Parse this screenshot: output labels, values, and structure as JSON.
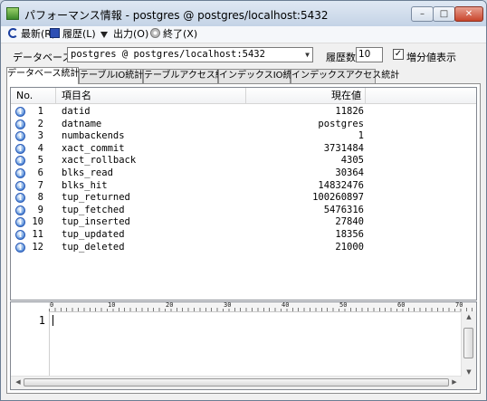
{
  "window": {
    "title": "パフォーマンス情報 - postgres @ postgres/localhost:5432",
    "minimize": "–",
    "maximize": "□",
    "close": "✕"
  },
  "menu": {
    "refresh": "最新(R)",
    "history": "履歴(L)",
    "output": "出力(O)",
    "exit": "終了(X)"
  },
  "toolbar": {
    "database_label": "データベース",
    "database_value": "postgres @ postgres/localhost:5432",
    "history_label": "履歴数",
    "history_value": "10",
    "increment_label": "増分値表示",
    "increment_checked": "✓"
  },
  "tabs": [
    "データベース統計",
    "テーブルIO統計",
    "テーブルアクセス統計",
    "インデックスIO統計",
    "インデックスアクセス統計"
  ],
  "list": {
    "columns": {
      "no": "No.",
      "name": "項目名",
      "value": "現在値"
    },
    "info_glyph": "i",
    "rows": [
      {
        "no": "1",
        "name": "datid",
        "value": "11826"
      },
      {
        "no": "2",
        "name": "datname",
        "value": "postgres"
      },
      {
        "no": "3",
        "name": "numbackends",
        "value": "1"
      },
      {
        "no": "4",
        "name": "xact_commit",
        "value": "3731484"
      },
      {
        "no": "5",
        "name": "xact_rollback",
        "value": "4305"
      },
      {
        "no": "6",
        "name": "blks_read",
        "value": "30364"
      },
      {
        "no": "7",
        "name": "blks_hit",
        "value": "14832476"
      },
      {
        "no": "8",
        "name": "tup_returned",
        "value": "100260897"
      },
      {
        "no": "9",
        "name": "tup_fetched",
        "value": "5476316"
      },
      {
        "no": "10",
        "name": "tup_inserted",
        "value": "27840"
      },
      {
        "no": "11",
        "name": "tup_updated",
        "value": "18356"
      },
      {
        "no": "12",
        "name": "tup_deleted",
        "value": "21000"
      }
    ]
  },
  "editor": {
    "line_number": "1",
    "ruler": [
      "0",
      "10",
      "20",
      "30",
      "40",
      "50",
      "60",
      "70"
    ]
  }
}
